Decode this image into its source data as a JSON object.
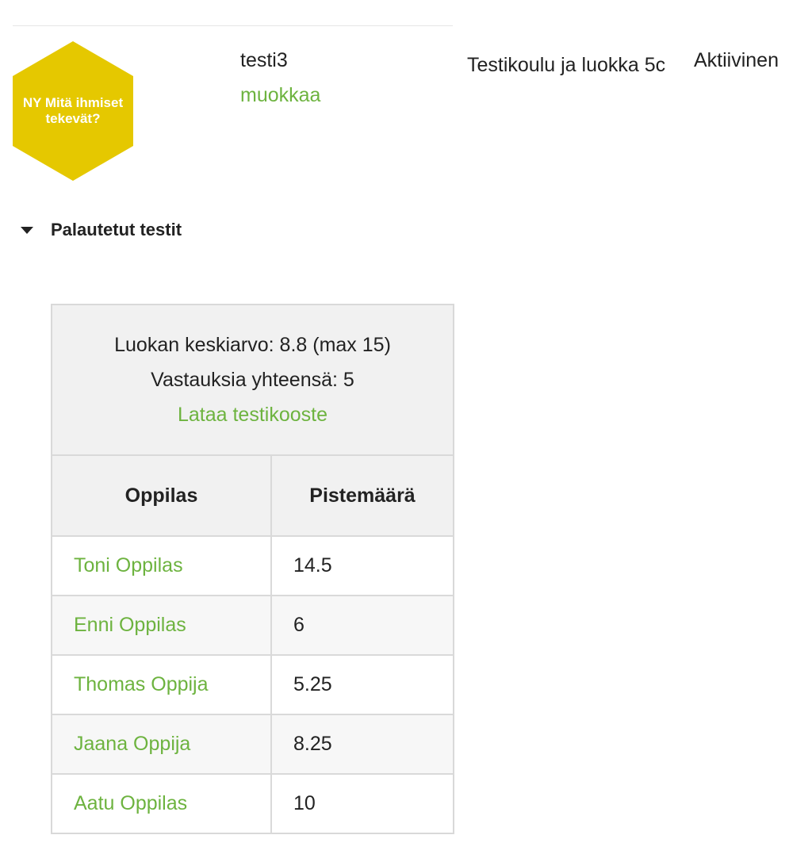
{
  "colors": {
    "accent_green": "#6db33f",
    "logo_yellow": "#e5c800",
    "header_gray": "#f1f1f1"
  },
  "test": {
    "logo_text": "NY Mitä ihmiset tekevät?",
    "name": "testi3",
    "edit_label": "muokkaa",
    "school_class": "Testikoulu ja luokka 5c",
    "status": "Aktiivinen"
  },
  "section": {
    "toggle_icon": "caret-down-icon",
    "title": "Palautetut testit"
  },
  "summary": {
    "class_average": "Luokan keskiarvo: 8.8 (max 15)",
    "total_answers": "Vastauksia yhteensä: 5",
    "download_label": "Lataa testikooste"
  },
  "table": {
    "columns": [
      "Oppilas",
      "Pistemäärä"
    ],
    "rows": [
      {
        "student": "Toni Oppilas",
        "score": "14.5"
      },
      {
        "student": "Enni Oppilas",
        "score": "6"
      },
      {
        "student": "Thomas Oppija",
        "score": "5.25"
      },
      {
        "student": "Jaana Oppija",
        "score": "8.25"
      },
      {
        "student": "Aatu Oppilas",
        "score": "10"
      }
    ]
  }
}
